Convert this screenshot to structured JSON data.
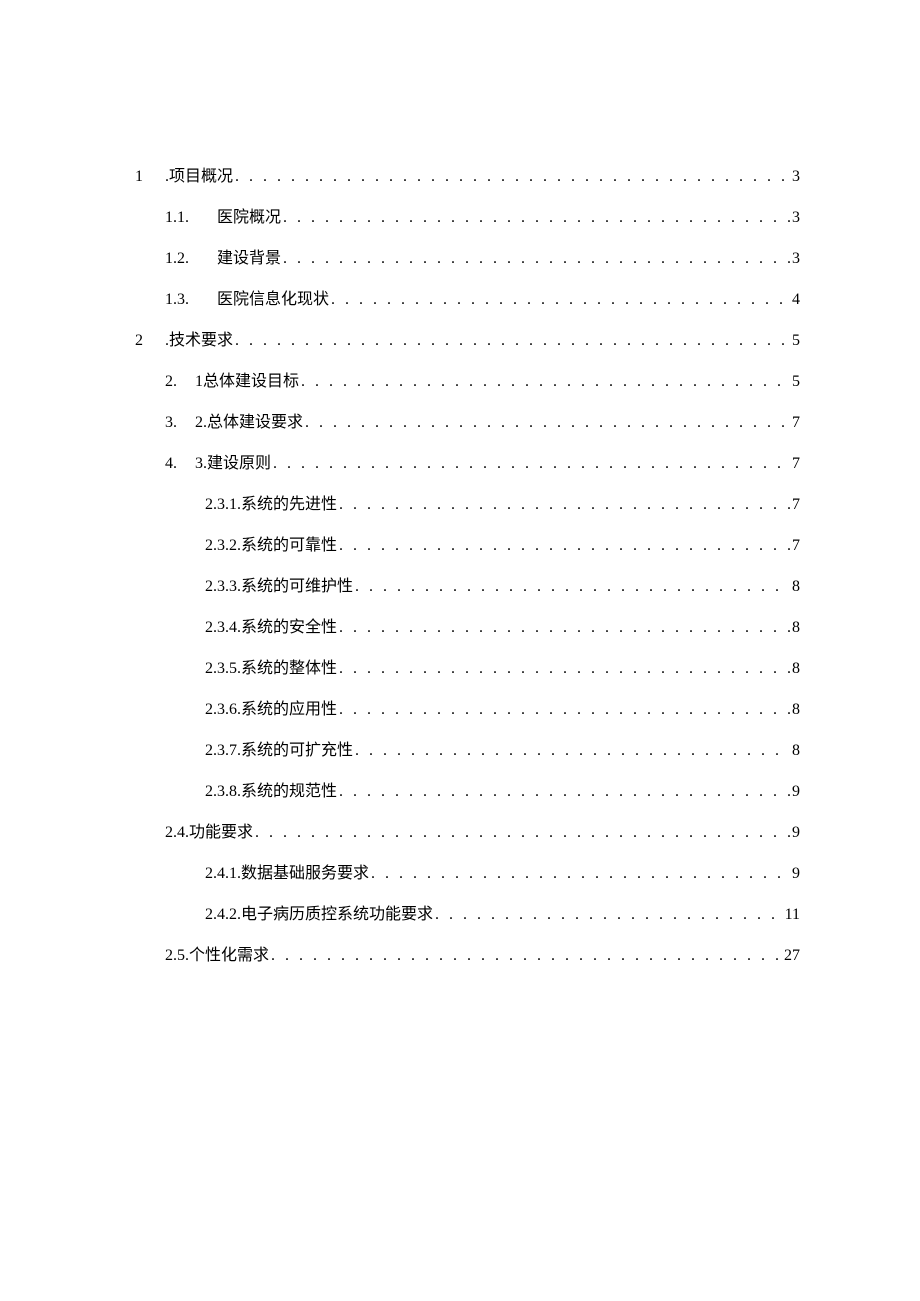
{
  "toc": [
    {
      "indent": 0,
      "num_col1": "1",
      "num_col2": "",
      "title": ".项目概况",
      "page": "3"
    },
    {
      "indent": 1,
      "num_col1": "",
      "num_col2": "1.1.",
      "title": "医院概况",
      "page": "3"
    },
    {
      "indent": 1,
      "num_col1": "",
      "num_col2": "1.2.",
      "title": "建设背景",
      "page": "3"
    },
    {
      "indent": 1,
      "num_col1": "",
      "num_col2": "1.3.",
      "title": "医院信息化现状",
      "page": "4"
    },
    {
      "indent": 0,
      "num_col1": "2",
      "num_col2": "",
      "title": ".技术要求",
      "page": "5"
    },
    {
      "indent": 1,
      "num_col1": "",
      "num_col2": "2.",
      "title": "1总体建设目标",
      "page": "5"
    },
    {
      "indent": 1,
      "num_col1": "",
      "num_col2": "3.",
      "title": "2.总体建设要求",
      "page": "7"
    },
    {
      "indent": 1,
      "num_col1": "",
      "num_col2": "4.",
      "title": "3.建设原则",
      "page": "7"
    },
    {
      "indent": 2,
      "num_col1": "",
      "num_col2": "",
      "title": "2.3.1.系统的先进性",
      "page": "7"
    },
    {
      "indent": 2,
      "num_col1": "",
      "num_col2": "",
      "title": "2.3.2.系统的可靠性",
      "page": "7"
    },
    {
      "indent": 2,
      "num_col1": "",
      "num_col2": "",
      "title": "2.3.3.系统的可维护性",
      "page": "8"
    },
    {
      "indent": 2,
      "num_col1": "",
      "num_col2": "",
      "title": "2.3.4.系统的安全性",
      "page": "8"
    },
    {
      "indent": 2,
      "num_col1": "",
      "num_col2": "",
      "title": "2.3.5.系统的整体性",
      "page": "8"
    },
    {
      "indent": 2,
      "num_col1": "",
      "num_col2": "",
      "title": "2.3.6.系统的应用性",
      "page": "8"
    },
    {
      "indent": 2,
      "num_col1": "",
      "num_col2": "",
      "title": "2.3.7.系统的可扩充性",
      "page": "8"
    },
    {
      "indent": 2,
      "num_col1": "",
      "num_col2": "",
      "title": "2.3.8.系统的规范性",
      "page": "9"
    },
    {
      "indent": 1,
      "num_col1": "",
      "num_col2": "",
      "title": "2.4.功能要求",
      "page": "9"
    },
    {
      "indent": 2,
      "num_col1": "",
      "num_col2": "",
      "title": "2.4.1.数据基础服务要求",
      "page": "9"
    },
    {
      "indent": 2,
      "num_col1": "",
      "num_col2": "",
      "title": "2.4.2.电子病历质控系统功能要求",
      "page": "11"
    },
    {
      "indent": 1,
      "num_col1": "",
      "num_col2": "",
      "title": "2.5.个性化需求",
      "page": "27"
    }
  ]
}
